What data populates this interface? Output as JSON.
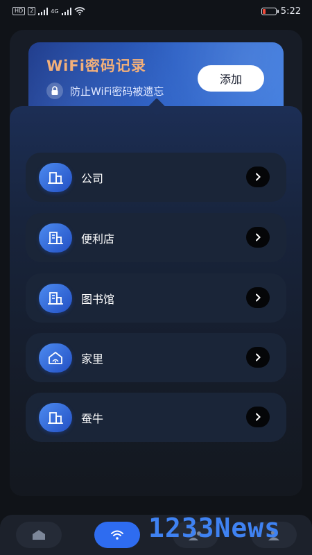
{
  "status_bar": {
    "left_tags": [
      "HD",
      "2"
    ],
    "network": "4G",
    "time": "5:22",
    "battery_level": 0.2,
    "battery_color": "#f04a3a"
  },
  "header": {
    "title": "WiFi密码记录",
    "subtitle": "防止WiFi密码被遗忘",
    "add_label": "添加",
    "title_color": "#f3b07a"
  },
  "wifi_list": [
    {
      "label": "公司",
      "icon": "office-building-icon"
    },
    {
      "label": "便利店",
      "icon": "store-building-icon"
    },
    {
      "label": "图书馆",
      "icon": "library-building-icon"
    },
    {
      "label": "家里",
      "icon": "home-icon"
    },
    {
      "label": "蚕牛",
      "icon": "office-building-icon"
    }
  ],
  "bottom_nav": {
    "items": [
      {
        "icon": "home-icon",
        "active": false
      },
      {
        "icon": "wifi-icon",
        "active": true
      },
      {
        "icon": "people-icon",
        "active": false
      },
      {
        "icon": "person-icon",
        "active": false
      }
    ],
    "accent": "#2e6cf0"
  },
  "watermark": "1233News"
}
